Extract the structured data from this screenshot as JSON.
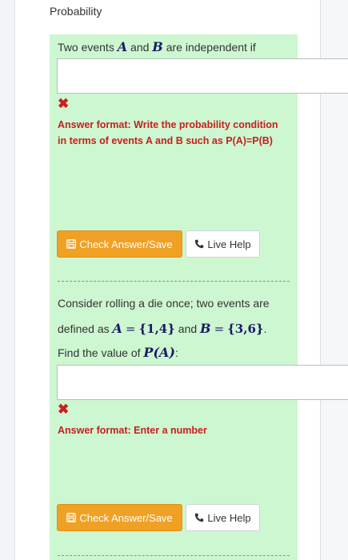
{
  "header": {
    "title": "Probability"
  },
  "q1": {
    "prompt": "Two events",
    "var_a": "A",
    "and": "and",
    "var_b": "B",
    "tail": "are independent if",
    "input_value": "",
    "format_text": "Answer format: Write the probability condition in terms of events A and B such as P(A)=P(B)",
    "check_label": "Check Answer/Save",
    "help_label": "Live Help"
  },
  "q2": {
    "line1": "Consider rolling a die once; two events are",
    "line2_pre": "defined as",
    "a_def_var": "A",
    "a_def_eq": "=",
    "a_def_set": "{1,4}",
    "and": "and",
    "b_def_var": "B",
    "b_def_eq": "=",
    "b_def_set": "{3,6}",
    "period": ".",
    "line3_pre": "Find the value of",
    "pa": "P(A)",
    "colon": ":",
    "input_value": "",
    "format_text": "Answer format: Enter a number",
    "check_label": "Check Answer/Save",
    "help_label": "Live Help"
  },
  "colors": {
    "accent": "#f0a124",
    "section_bg": "#cdf7d0",
    "error": "#c81e1e"
  }
}
